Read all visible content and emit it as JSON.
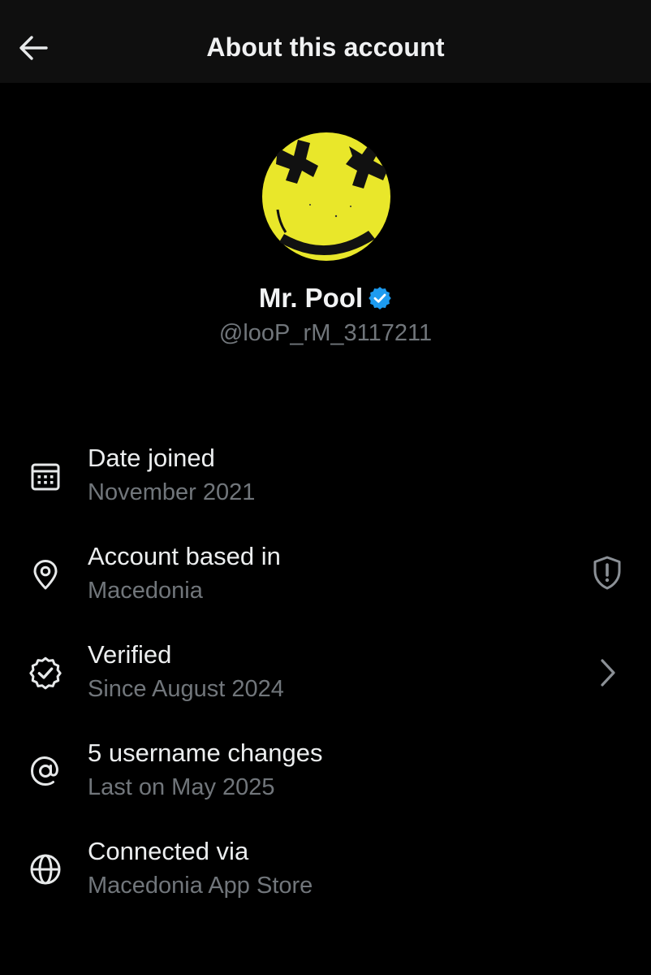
{
  "header": {
    "title": "About this account",
    "back_icon": "arrow-left-icon"
  },
  "profile": {
    "display_name": "Mr. Pool",
    "handle": "@looP_rM_3117211",
    "verified": true,
    "verified_color": "#1d9bf0",
    "avatar_color": "#e9e72a"
  },
  "info": [
    {
      "icon": "calendar-icon",
      "title": "Date joined",
      "subtitle": "November 2021"
    },
    {
      "icon": "location-pin-icon",
      "title": "Account based in",
      "subtitle": "Macedonia",
      "right_icon": "shield-alert-icon"
    },
    {
      "icon": "verified-check-icon",
      "title": "Verified",
      "subtitle": "Since August 2024",
      "right_icon": "chevron-right-icon"
    },
    {
      "icon": "at-sign-icon",
      "title": "5 username changes",
      "subtitle": "Last on May 2025"
    },
    {
      "icon": "globe-icon",
      "title": "Connected via",
      "subtitle": "Macedonia App Store"
    }
  ],
  "colors": {
    "background": "#000000",
    "header_background": "#0f0f0f",
    "primary_text": "#e7e9ea",
    "secondary_text": "#71767b"
  }
}
